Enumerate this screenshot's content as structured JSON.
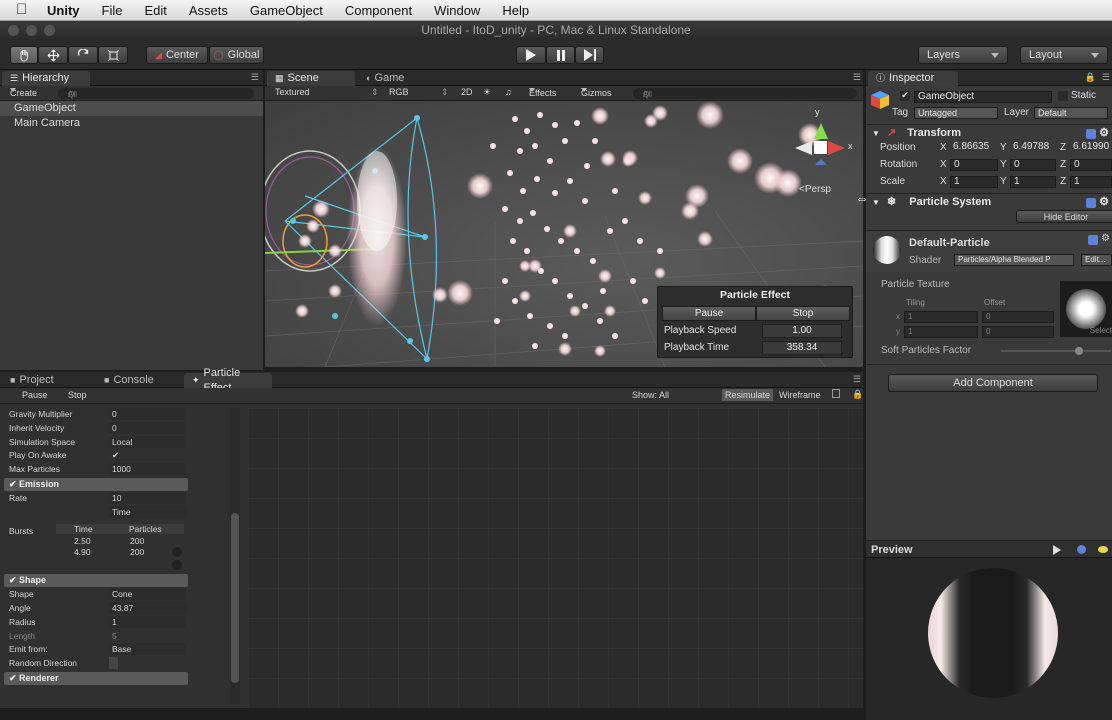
{
  "menubar": {
    "app": "Unity",
    "items": [
      "File",
      "Edit",
      "Assets",
      "GameObject",
      "Component",
      "Window",
      "Help"
    ]
  },
  "window_title": "Untitled - ItoD_unity - PC, Mac & Linux Standalone",
  "toolbar": {
    "center": "Center",
    "global": "Global",
    "layers": "Layers",
    "layout": "Layout"
  },
  "hierarchy": {
    "tab": "Hierarchy",
    "create": "Create",
    "search": "All",
    "items": [
      "GameObject",
      "Main Camera"
    ]
  },
  "scene": {
    "tab_scene": "Scene",
    "tab_game": "Game",
    "render_mode": "Textured",
    "color_mode": "RGB",
    "mode_2d": "2D",
    "effects": "Effects",
    "gizmos": "Gizmos",
    "search": "All",
    "persp": "Persp",
    "gizmo_y": "y",
    "gizmo_x": "x",
    "particle_effect": {
      "title": "Particle Effect",
      "pause": "Pause",
      "stop": "Stop",
      "playback_speed_label": "Playback Speed",
      "playback_speed": "1.00",
      "playback_time_label": "Playback Time",
      "playback_time": "358.34"
    }
  },
  "bottom": {
    "tab_project": "Project",
    "tab_console": "Console",
    "tab_particle": "Particle Effect",
    "pause": "Pause",
    "stop": "Stop",
    "show_all": "Show: All",
    "resimulate": "Resimulate",
    "wireframe": "Wireframe",
    "props_top": [
      {
        "k": "Gravity Multiplier",
        "v": "0"
      },
      {
        "k": "Inherit Velocity",
        "v": "0"
      },
      {
        "k": "Simulation Space",
        "v": "Local"
      },
      {
        "k": "Play On Awake",
        "v": "✔"
      },
      {
        "k": "Max Particles",
        "v": "1000"
      }
    ],
    "emission": "Emission",
    "rate_label": "Rate",
    "rate_value": "10",
    "rate_mode": "Time",
    "bursts_label": "Bursts",
    "bursts_col_time": "Time",
    "bursts_col_particles": "Particles",
    "bursts": [
      {
        "time": "2.50",
        "particles": "200"
      },
      {
        "time": "4.90",
        "particles": "200"
      }
    ],
    "shape_section": "Shape",
    "shape_props": [
      {
        "k": "Shape",
        "v": "Cone"
      },
      {
        "k": "Angle",
        "v": "43.87"
      },
      {
        "k": "Radius",
        "v": "1"
      },
      {
        "k": "Length",
        "v": "5"
      },
      {
        "k": "Emit from:",
        "v": "Base"
      },
      {
        "k": "Random Direction",
        "v": ""
      }
    ],
    "renderer": "Renderer"
  },
  "inspector": {
    "tab": "Inspector",
    "object_name": "GameObject",
    "static": "Static",
    "tag_label": "Tag",
    "tag_value": "Untagged",
    "layer_label": "Layer",
    "layer_value": "Default",
    "transform": "Transform",
    "position_label": "Position",
    "rotation_label": "Rotation",
    "scale_label": "Scale",
    "position": {
      "x": "6.86635",
      "y": "6.49788",
      "z": "6.61990"
    },
    "rotation": {
      "x": "0",
      "y": "0",
      "z": "0"
    },
    "scale": {
      "x": "1",
      "y": "1",
      "z": "1"
    },
    "axis_x": "X",
    "axis_y": "Y",
    "axis_z": "Z",
    "particle_system": "Particle System",
    "hide_editor": "Hide Editor",
    "material_name": "Default-Particle",
    "shader_label": "Shader",
    "shader_value": "Particles/Alpha Blended P",
    "edit": "Edit...",
    "particle_texture": "Particle Texture",
    "tiling": "Tiling",
    "offset": "Offset",
    "tiling_x": "1",
    "tiling_y": "1",
    "offset_x": "0",
    "offset_y": "0",
    "select": "Select",
    "soft_particles": "Soft Particles Factor",
    "add_component": "Add Component"
  },
  "preview": {
    "label": "Preview"
  }
}
